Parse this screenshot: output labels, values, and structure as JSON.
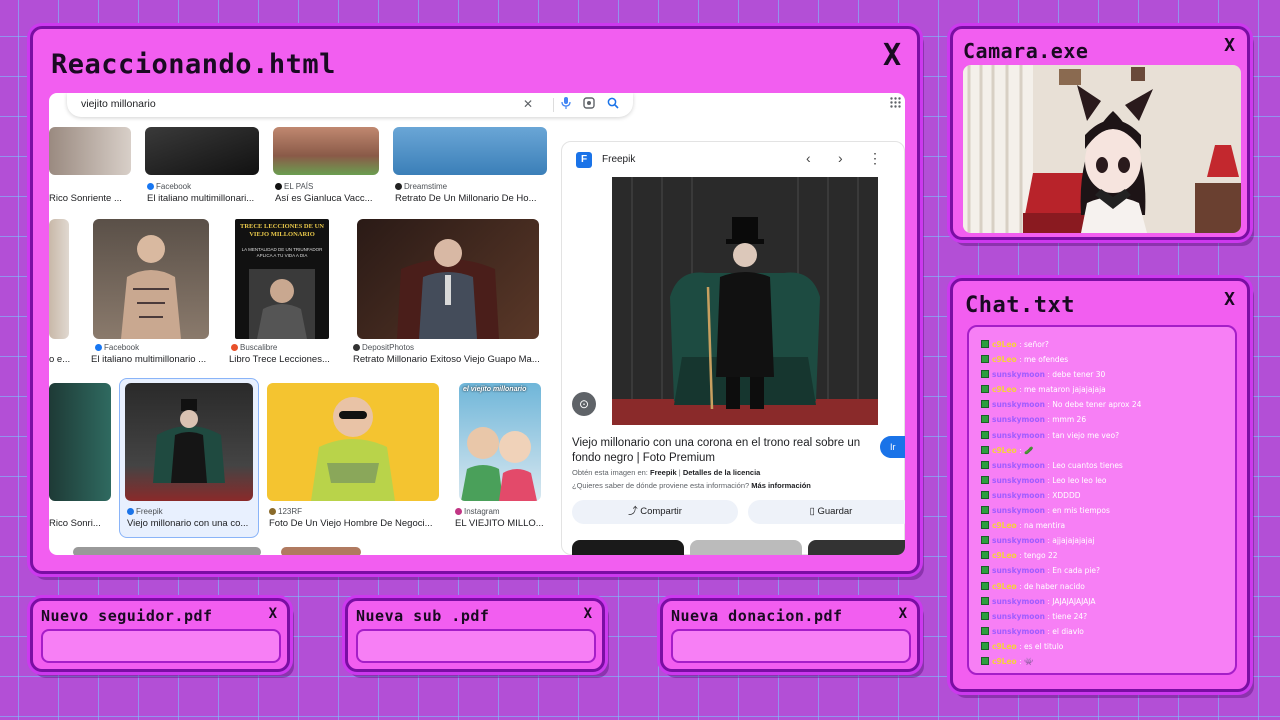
{
  "main_window": {
    "title": "Reaccionando.html",
    "close_glyph": "X",
    "browser": {
      "search_query": "viejito millonario",
      "results": [
        {
          "source": "",
          "caption": "Rico Sonriente ..."
        },
        {
          "source": "Facebook",
          "caption": "El italiano multimillonari..."
        },
        {
          "source": "EL PAÍS",
          "caption": "Así es Gianluca Vacc..."
        },
        {
          "source": "Dreamstime",
          "caption": "Retrato De Un Millonario De Ho..."
        },
        {
          "source": "",
          "caption": "o e..."
        },
        {
          "source": "Facebook",
          "caption": "El italiano multimillonario ..."
        },
        {
          "source": "Buscalibre",
          "caption": "Libro Trece Lecciones..."
        },
        {
          "source": "DepositPhotos",
          "caption": "Retrato Millonario Exitoso Viejo Guapo Ma..."
        },
        {
          "source": "",
          "caption": "Rico Sonri..."
        },
        {
          "source": "Freepik",
          "caption": "Viejo millonario con una co..."
        },
        {
          "source": "123RF",
          "caption": "Foto De Un Viejo Hombre De Negoci..."
        },
        {
          "source": "Instagram",
          "caption": "EL VIEJITO MILLO..."
        }
      ],
      "book_cover": {
        "title": "TRECE LECCIONES DE UN VIEJO MILLONARIO",
        "subtitle": "LA MENTALIDAD DE UN TRIUNFADOR APLICA A TU VIDA A DIA"
      },
      "insta_overlay": "el viejito millonario",
      "preview": {
        "brand": "Freepik",
        "title": "Viejo millonario con una corona en el trono real sobre un fondo negro | Foto Premium",
        "go_label": "Ir",
        "source_prefix": "Obtén esta imagen en:",
        "source_name": "Freepik",
        "source_sep": "|",
        "license_link": "Detalles de la licencia",
        "question": "¿Quieres saber de dónde proviene esta información?",
        "more_info": "Más información",
        "share_label": "Compartir",
        "save_label": "Guardar"
      }
    }
  },
  "camera_window": {
    "title": "Camara.exe",
    "close_glyph": "X"
  },
  "chat_window": {
    "title": "Chat.txt",
    "close_glyph": "X",
    "messages": [
      {
        "user": "c9Leo",
        "text": "señor?"
      },
      {
        "user": "c9Leo",
        "text": "me ofendes"
      },
      {
        "user": "sunskymoon",
        "text": "debe tener 30"
      },
      {
        "user": "c9Leo",
        "text": "me mataron jajajajaja"
      },
      {
        "user": "sunskymoon",
        "text": "No debe tener aprox 24"
      },
      {
        "user": "sunskymoon",
        "text": "mmm 26"
      },
      {
        "user": "sunskymoon",
        "text": "tan viejo me veo?"
      },
      {
        "user": "c9Leo",
        "text": "🥒"
      },
      {
        "user": "sunskymoon",
        "text": "Leo cuantos tienes"
      },
      {
        "user": "sunskymoon",
        "text": "Leo leo leo leo"
      },
      {
        "user": "sunskymoon",
        "text": "XDDDD"
      },
      {
        "user": "sunskymoon",
        "text": "en mis tiempos"
      },
      {
        "user": "c9Leo",
        "text": "na mentira"
      },
      {
        "user": "sunskymoon",
        "text": "ajjajajajajaj"
      },
      {
        "user": "c9Leo",
        "text": "tengo 22"
      },
      {
        "user": "sunskymoon",
        "text": "En cada pie?"
      },
      {
        "user": "c9Leo",
        "text": "de haber nacido"
      },
      {
        "user": "sunskymoon",
        "text": "JAJAJAJAJAJA"
      },
      {
        "user": "sunskymoon",
        "text": "tiene 24?"
      },
      {
        "user": "sunskymoon",
        "text": "el diavlo"
      },
      {
        "user": "c9Leo",
        "text": "es el titulo"
      },
      {
        "user": "c9Leo",
        "text": "👾"
      }
    ]
  },
  "alerts": [
    {
      "title": "Nuevo seguidor.pdf",
      "close_glyph": "X"
    },
    {
      "title": "Nueva sub .pdf",
      "close_glyph": "X"
    },
    {
      "title": "Nueva donacion.pdf",
      "close_glyph": "X"
    }
  ],
  "icons": {
    "clear": "✕",
    "mic": "🎤",
    "lens": "⊙",
    "search": "⌕",
    "apps": "⋮⋮⋮",
    "prev": "‹",
    "next": "›",
    "more": "⋮",
    "share": "⤴",
    "bookmark": "🔖"
  },
  "colors": {
    "background": "#b34fd6",
    "grid": "#78c8ff",
    "window_fill": "#f25ef0",
    "window_border": "#7a0ea3",
    "chat_user_a": "#f7d23a",
    "chat_user_b": "#a05cff",
    "accent_blue": "#1a73e8"
  }
}
